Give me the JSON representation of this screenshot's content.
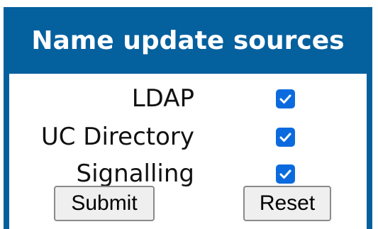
{
  "header": {
    "title": "Name update sources"
  },
  "sources": [
    {
      "label": "LDAP",
      "checked": true
    },
    {
      "label": "UC Directory",
      "checked": true
    },
    {
      "label": "Signalling",
      "checked": true
    }
  ],
  "buttons": {
    "submit": "Submit",
    "reset": "Reset"
  },
  "colors": {
    "header_bg": "#05609e",
    "checkbox": "#0b6bde"
  }
}
